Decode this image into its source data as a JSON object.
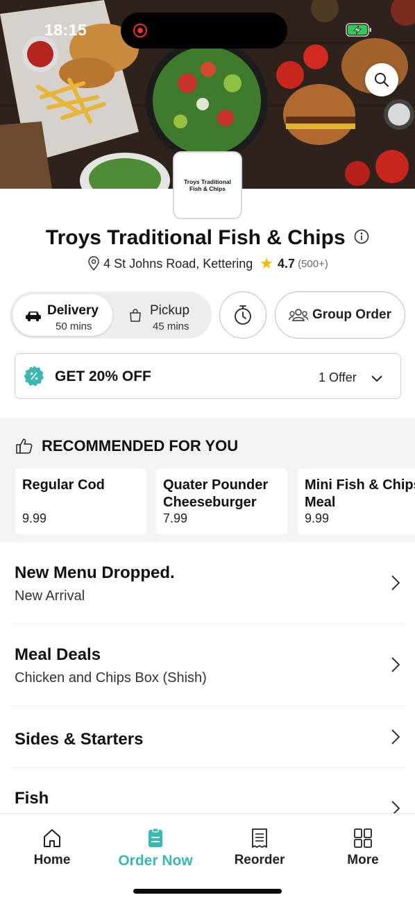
{
  "status_bar": {
    "time": "18:15"
  },
  "hero": {
    "search_icon": "search-icon"
  },
  "restaurant": {
    "logo_text": "Troys Traditional Fish & Chips",
    "name": "Troys Traditional Fish & Chips",
    "address": "4 St Johns Road, Kettering",
    "rating": "4.7",
    "review_count": "(500+)"
  },
  "order_mode": {
    "delivery": {
      "label": "Delivery",
      "time": "50 mins",
      "selected": true
    },
    "pickup": {
      "label": "Pickup",
      "time": "45 mins",
      "selected": false
    },
    "group_order_label": "Group Order"
  },
  "offer": {
    "title": "GET 20% OFF",
    "count": "1 Offer"
  },
  "recommended": {
    "heading": "RECOMMENDED FOR YOU",
    "items": [
      {
        "name": "Regular Cod",
        "price": "9.99"
      },
      {
        "name": "Quater Pounder Cheeseburger &...",
        "price": "7.99"
      },
      {
        "name": "Mini Fish & Chips Meal",
        "price": "9.99"
      }
    ]
  },
  "menu": [
    {
      "title": "New Menu Dropped.",
      "subtitle": "New Arrival"
    },
    {
      "title": "Meal Deals",
      "subtitle": "Chicken and Chips Box (Shish)"
    },
    {
      "title": "Sides & Starters",
      "subtitle": ""
    },
    {
      "title": "Fish",
      "subtitle": ""
    }
  ],
  "bottom_nav": [
    {
      "label": "Home",
      "icon": "home-icon"
    },
    {
      "label": "Order Now",
      "icon": "order-icon",
      "active": true
    },
    {
      "label": "Reorder",
      "icon": "receipt-icon"
    },
    {
      "label": "More",
      "icon": "grid-icon"
    }
  ],
  "colors": {
    "accent": "#3ab7b0",
    "star": "#f6b800",
    "record": "#e5342b"
  }
}
